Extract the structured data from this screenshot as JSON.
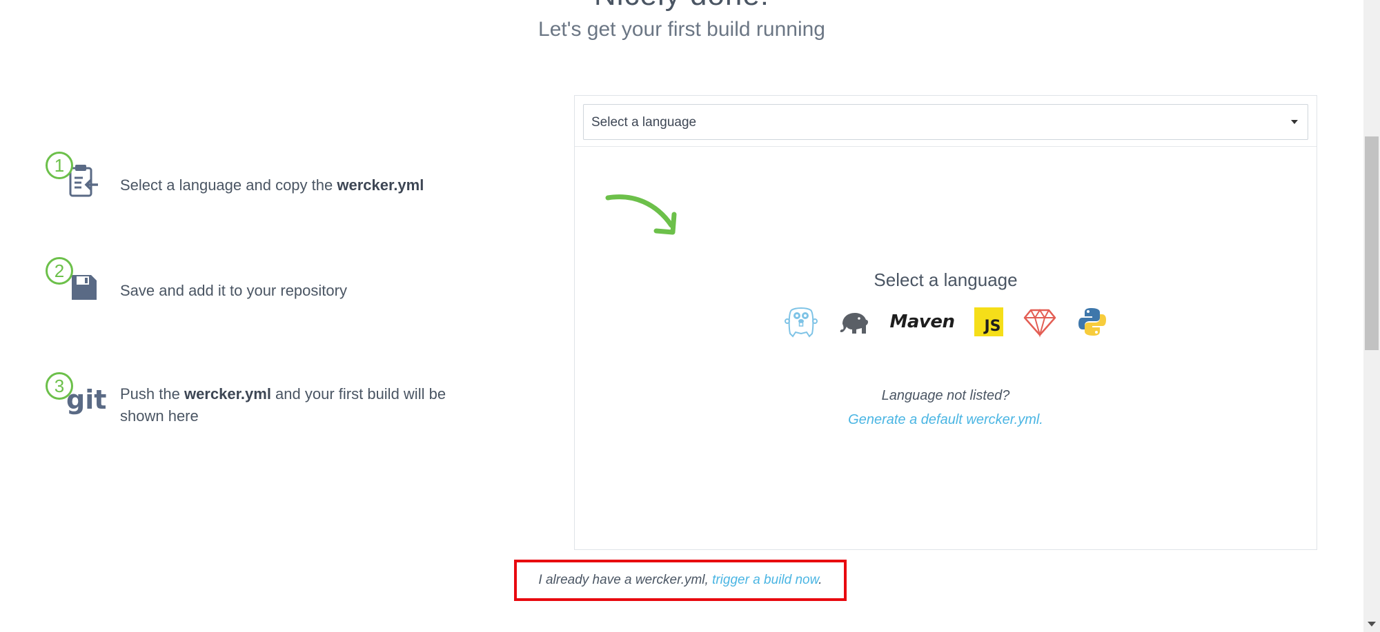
{
  "header": {
    "title": "Nicely done!",
    "subtitle": "Let's get your first build running"
  },
  "steps": [
    {
      "number": "1",
      "icon": "clipboard-icon",
      "text_before": "Select a language and copy the ",
      "text_bold": "wercker.yml",
      "text_after": ""
    },
    {
      "number": "2",
      "icon": "floppy-disk-icon",
      "text_before": "Save and add it to your repository",
      "text_bold": "",
      "text_after": ""
    },
    {
      "number": "3",
      "icon": "git-icon",
      "icon_text": "git",
      "text_before": "Push the ",
      "text_bold": "wercker.yml",
      "text_after": " and your first build will be shown here"
    }
  ],
  "panel": {
    "select": {
      "value": "Select a language"
    },
    "heading": "Select a language",
    "languages": [
      {
        "name": "Go",
        "icon": "go-gopher-icon"
      },
      {
        "name": "Gradle",
        "icon": "elephant-icon"
      },
      {
        "name": "Maven",
        "icon": "maven-icon",
        "label": "Maven"
      },
      {
        "name": "JavaScript",
        "icon": "js-icon",
        "label": "JS"
      },
      {
        "name": "Ruby",
        "icon": "ruby-icon"
      },
      {
        "name": "Python",
        "icon": "python-icon"
      }
    ],
    "not_listed": "Language not listed?",
    "generate_link": "Generate a default wercker.yml."
  },
  "footer": {
    "text_before": "I already have a wercker.yml, ",
    "link": "trigger a build now",
    "text_after": "."
  },
  "colors": {
    "accent_green": "#6cc04a",
    "link_blue": "#4ab5e3",
    "highlight_red": "#e8080f",
    "text": "#4a5563"
  }
}
